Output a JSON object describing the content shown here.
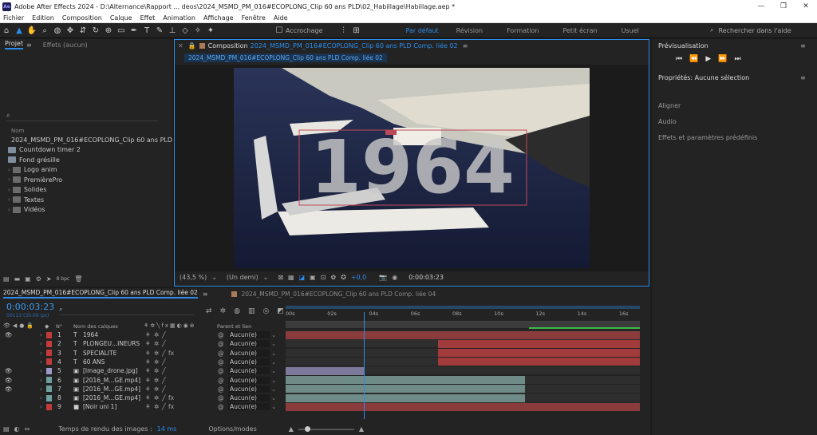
{
  "window": {
    "title": "Adobe After Effects 2024 - D:\\Alternance\\Rapport ... deos\\2024_MSMD_PM_016#ECOPLONG_Clip 60 ans PLD\\02_Habillage\\Habillage.aep *",
    "logo": "Ae"
  },
  "menu": [
    "Fichier",
    "Edition",
    "Composition",
    "Calque",
    "Effet",
    "Animation",
    "Affichage",
    "Fenêtre",
    "Aide"
  ],
  "toolbar": {
    "snap_label": "Accrochage",
    "workspaces": [
      "Par défaut",
      "Révision",
      "Formation",
      "Petit écran",
      "Usuel"
    ],
    "search_placeholder": "Rechercher dans l'aide"
  },
  "project": {
    "tab": "Projet",
    "effects_tab": "Effets (aucun)",
    "name_col": "Nom",
    "items": [
      {
        "name": "2024_MSMD_PM_016#ECOPLONG_Clip 60 ans PLD C",
        "kind": "comp"
      },
      {
        "name": "Countdown timer 2",
        "kind": "comp"
      },
      {
        "name": "Fond grésille",
        "kind": "comp"
      },
      {
        "name": "Logo anim",
        "kind": "folder"
      },
      {
        "name": "PremièrePro",
        "kind": "folder"
      },
      {
        "name": "Solides",
        "kind": "folder"
      },
      {
        "name": "Textes",
        "kind": "folder"
      },
      {
        "name": "Vidéos",
        "kind": "folder"
      }
    ],
    "bpc": "8 bpc"
  },
  "composition": {
    "tab_prefix": "Composition",
    "tab_name": "2024_MSMD_PM_016#ECOPLONG_Clip 60 ans PLD Comp. liée 02",
    "breadcrumb": "2024_MSMD_PM_016#ECOPLONG_Clip 60 ans PLD Comp. liée 02",
    "overlay_text": "1964",
    "zoom": "(43,5 %)",
    "resolution": "(Un demi)",
    "exposure": "+0,0",
    "timecode": "0:00:03:23"
  },
  "right": {
    "preview": "Prévisualisation",
    "properties": "Propriétés: Aucune sélection",
    "items": [
      "Aligner",
      "Audio",
      "Effets et paramètres prédéfinis"
    ]
  },
  "timeline": {
    "tab": "2024_MSMD_PM_016#ECOPLONG_Clip 60 ans PLD Comp. liée 02",
    "tab2": "2024_MSMD_PM_016#ECOPLONG_Clip 60 ans PLD Comp. liée 04",
    "timecode": "0:00:03:23",
    "frames": "00113 (30.00 ips)",
    "col_num": "N°",
    "col_name": "Nom des calques",
    "col_parent": "Parent et lien",
    "ruler": [
      "00s",
      "02s",
      "04s",
      "06s",
      "08s",
      "10s",
      "12s",
      "14s",
      "16s"
    ],
    "playhead_s": 3.77,
    "layers": [
      {
        "n": "1",
        "type": "T",
        "name": "1964",
        "color": "#c23a3a",
        "parent": "Aucun(e)",
        "eye": true,
        "start": 0,
        "end": 17,
        "bar": "#8a3b3b"
      },
      {
        "n": "2",
        "type": "T",
        "name": "PLONGEU...INEURS",
        "color": "#c23a3a",
        "parent": "Aucun(e)",
        "eye": false,
        "start": 7.3,
        "end": 17,
        "bar": "#a23b3b"
      },
      {
        "n": "3",
        "type": "T",
        "name": "SPECIALITE",
        "color": "#c23a3a",
        "parent": "Aucun(e)",
        "eye": false,
        "start": 7.3,
        "end": 17,
        "bar": "#a23b3b"
      },
      {
        "n": "4",
        "type": "T",
        "name": "60 ANS",
        "color": "#c23a3a",
        "parent": "Aucun(e)",
        "eye": false,
        "start": 7.3,
        "end": 17,
        "bar": "#a23b3b"
      },
      {
        "n": "5",
        "type": "img",
        "name": "[Image_drone.jpg]",
        "color": "#9a9ac8",
        "parent": "Aucun(e)",
        "eye": true,
        "start": 0,
        "end": 3.8,
        "bar": "#7b7a9a"
      },
      {
        "n": "6",
        "type": "vid",
        "name": "[2016_M...GE.mp4]",
        "color": "#6fa0a0",
        "parent": "Aucun(e)",
        "eye": true,
        "start": 0,
        "end": 11.5,
        "bar": "#6f8b87"
      },
      {
        "n": "7",
        "type": "vid",
        "name": "[2016_M...GE.mp4]",
        "color": "#6fa0a0",
        "parent": "Aucun(e)",
        "eye": true,
        "start": 0,
        "end": 11.5,
        "bar": "#6f8b87"
      },
      {
        "n": "8",
        "type": "vid",
        "name": "[2016_M...GE.mp4]",
        "color": "#6fa0a0",
        "parent": "Aucun(e)",
        "eye": false,
        "start": 0,
        "end": 11.5,
        "bar": "#6f8b87"
      },
      {
        "n": "9",
        "type": "solid",
        "name": "[Noir uni 1]",
        "color": "#c23a3a",
        "parent": "Aucun(e)",
        "eye": false,
        "start": 0,
        "end": 17,
        "bar": "#8a3b3b"
      }
    ],
    "render_label": "Temps de rendu des images :",
    "render_value": "14 ms",
    "options": "Options/modes"
  },
  "colors": {
    "accent": "#2d8ceb",
    "panel": "#232323",
    "bg": "#1d1d1d"
  }
}
